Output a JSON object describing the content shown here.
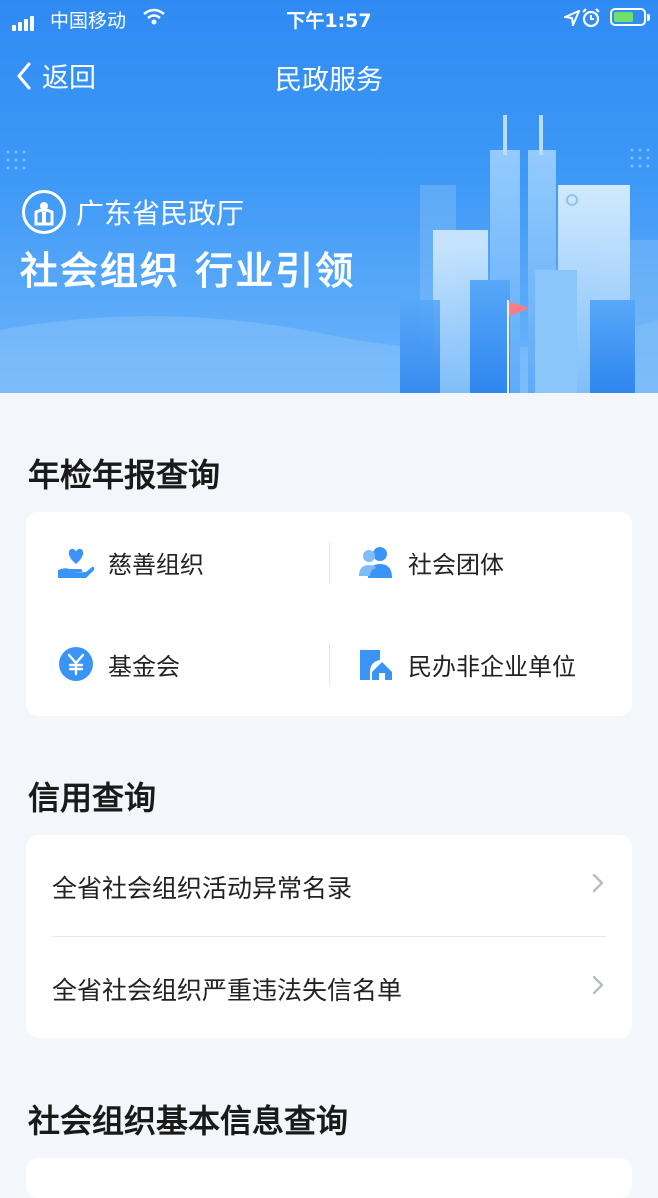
{
  "status_bar": {
    "carrier": "中国移动",
    "time": "下午1:57"
  },
  "nav": {
    "back_label": "返回",
    "title": "民政服务"
  },
  "banner": {
    "org_name": "广东省民政厅",
    "slogan": "社会组织 行业引领"
  },
  "annual_section": {
    "title": "年检年报查询",
    "items": [
      {
        "label": "慈善组织",
        "icon": "heart-hand-icon"
      },
      {
        "label": "社会团体",
        "icon": "people-icon"
      },
      {
        "label": "基金会",
        "icon": "yuan-coin-icon"
      },
      {
        "label": "民办非企业单位",
        "icon": "building-icon"
      }
    ]
  },
  "credit_section": {
    "title": "信用查询",
    "items": [
      {
        "label": "全省社会组织活动异常名录"
      },
      {
        "label": "全省社会组织严重违法失信名单"
      }
    ]
  },
  "basic_section": {
    "title": "社会组织基本信息查询"
  },
  "colors": {
    "accent": "#3a94f5",
    "page_bg": "#f3f6fb",
    "card_bg": "#ffffff"
  }
}
